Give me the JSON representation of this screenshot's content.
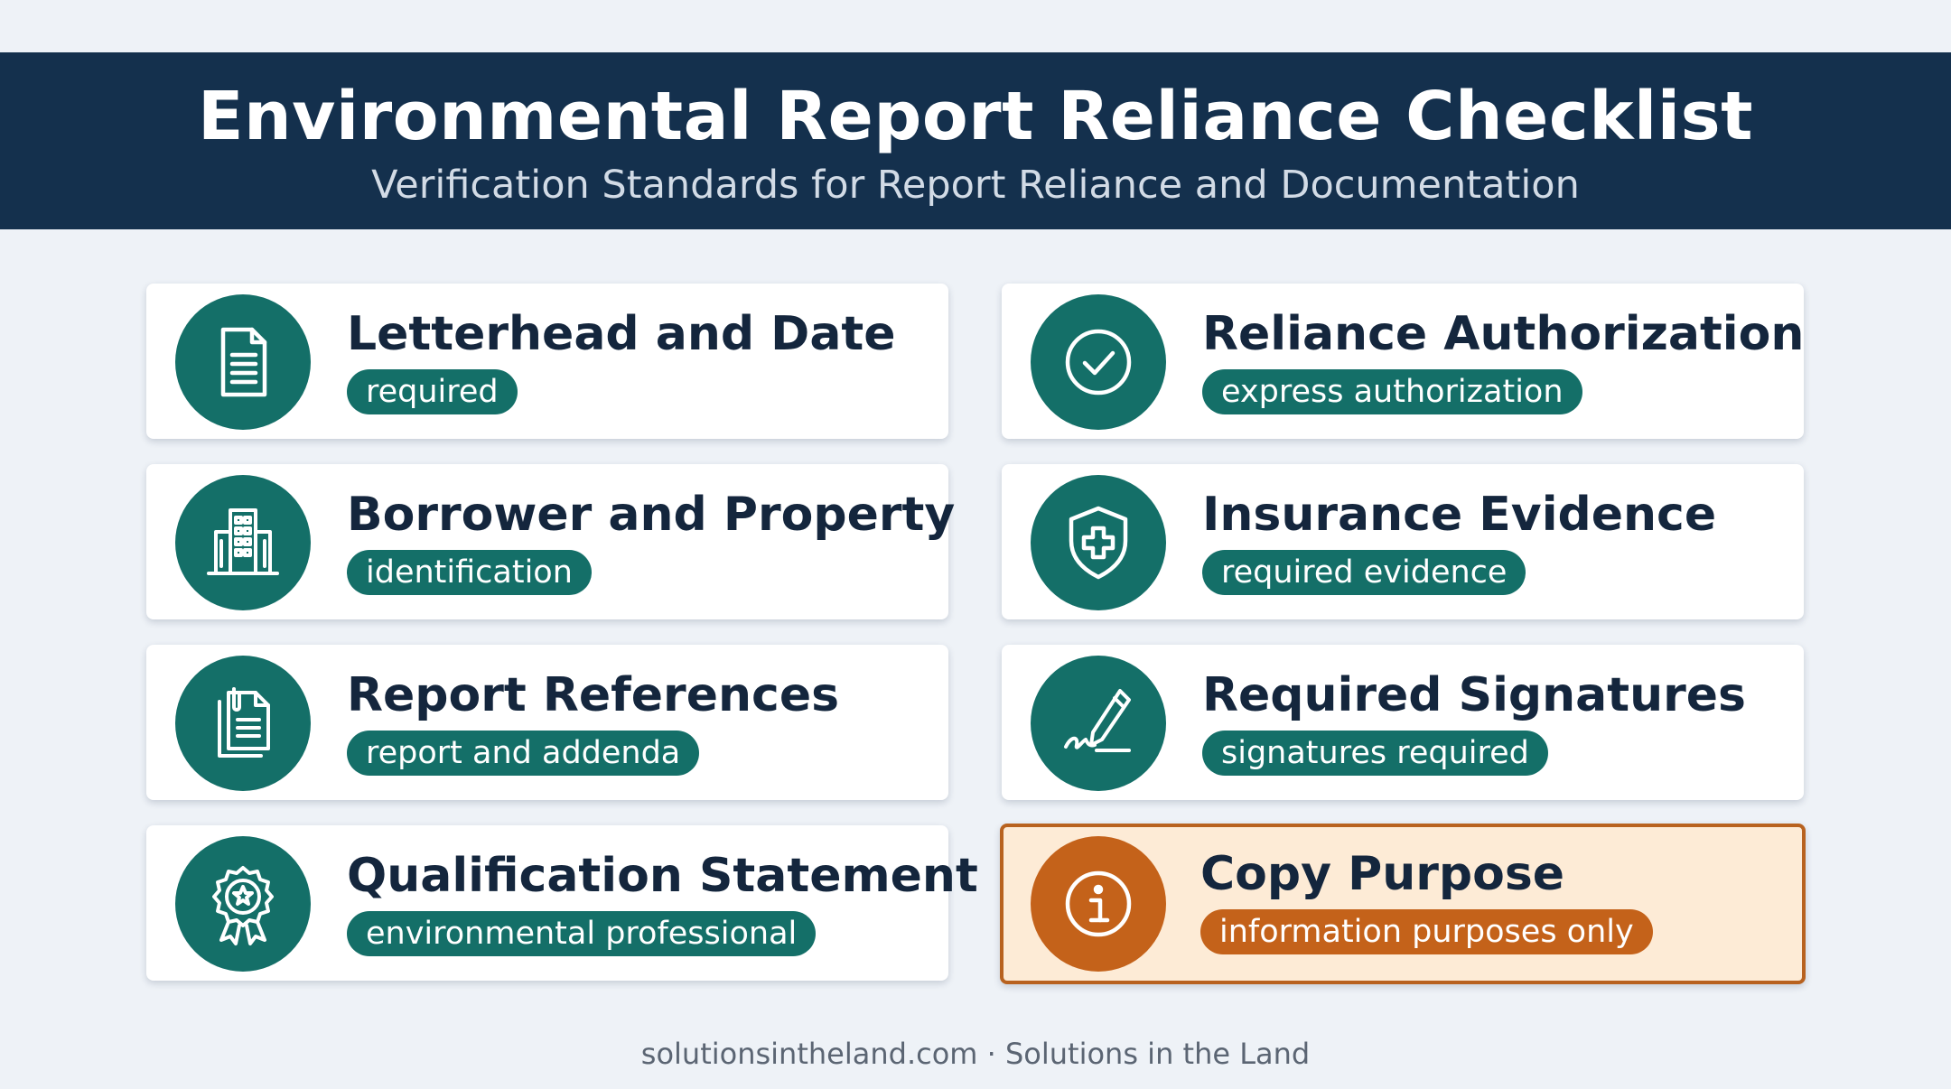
{
  "header": {
    "title": "Environmental Report Reliance Checklist",
    "subtitle": "Verification Standards for Report Reliance and Documentation"
  },
  "items": [
    {
      "title": "Letterhead and Date",
      "badge": "required",
      "icon": "document-icon"
    },
    {
      "title": "Reliance Authorization",
      "badge": "express authorization",
      "icon": "check-circle-icon"
    },
    {
      "title": "Borrower and Property",
      "badge": "identification",
      "icon": "building-icon"
    },
    {
      "title": "Insurance Evidence",
      "badge": "required evidence",
      "icon": "shield-plus-icon"
    },
    {
      "title": "Report References",
      "badge": "report and addenda",
      "icon": "stacked-documents-icon"
    },
    {
      "title": "Required Signatures",
      "badge": "signatures required",
      "icon": "pen-signature-icon"
    },
    {
      "title": "Qualification Statement",
      "badge": "environmental professional",
      "icon": "award-ribbon-icon"
    },
    {
      "title": "Copy Purpose",
      "badge": "information purposes only",
      "icon": "info-icon"
    }
  ],
  "footer": {
    "text": "solutionsintheland.com · Solutions in the Land"
  },
  "colors": {
    "header_bg": "#14304d",
    "teal_accent": "#146f68",
    "orange_accent": "#c4621a",
    "highlight_bg": "#fdebd6"
  }
}
